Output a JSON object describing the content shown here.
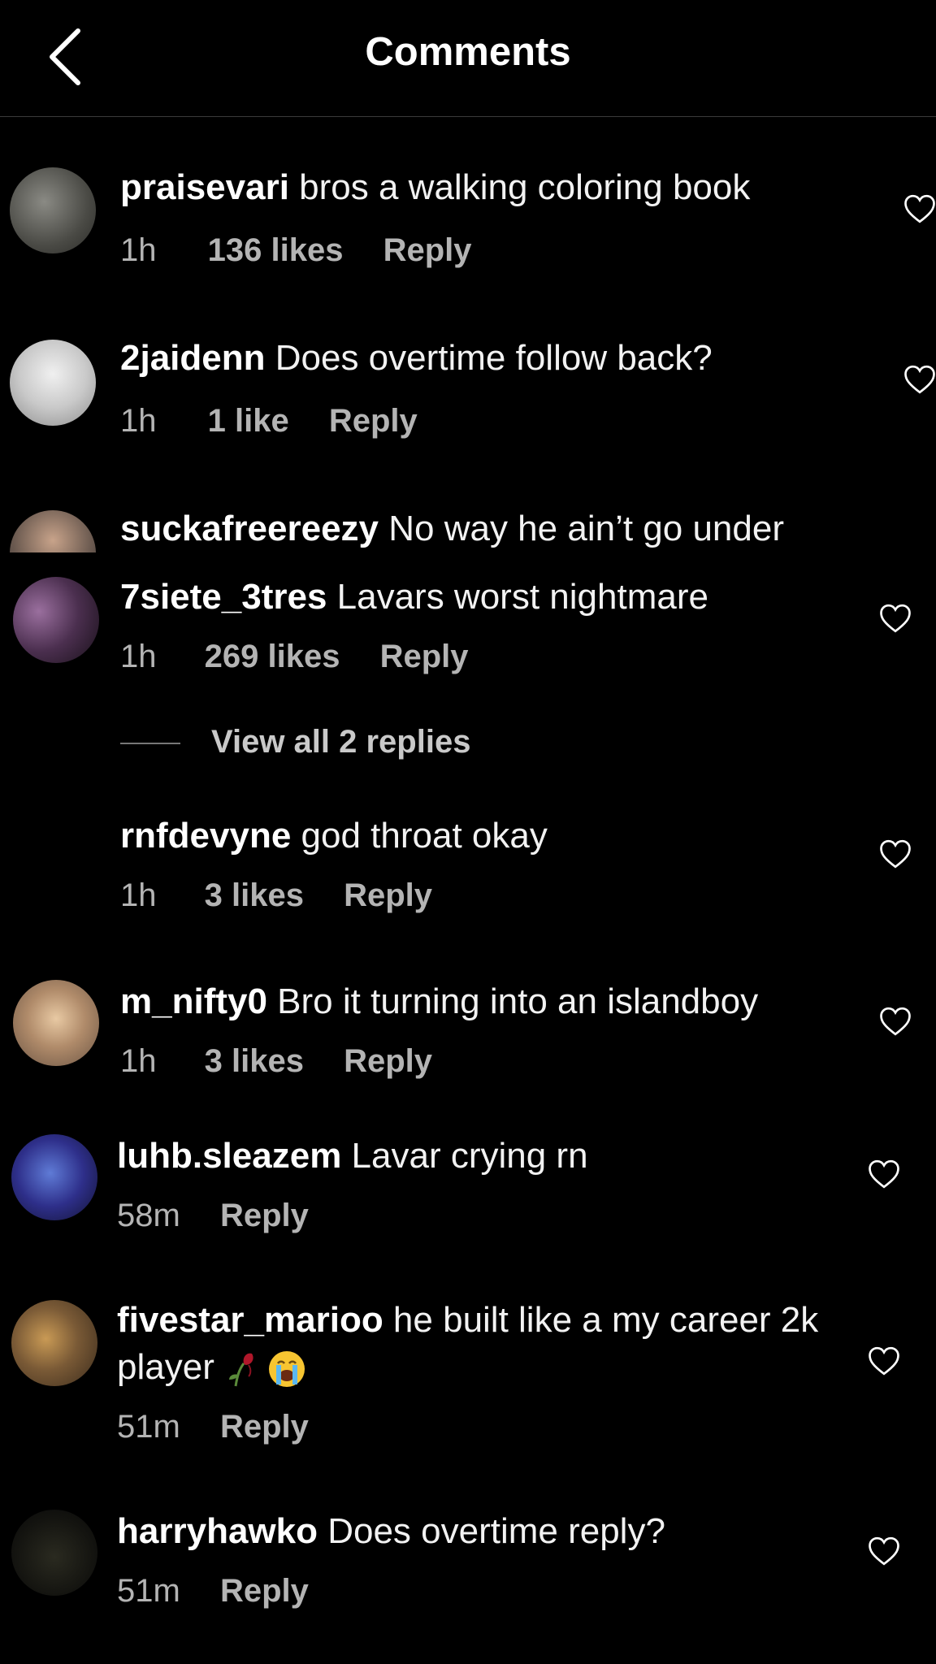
{
  "header": {
    "title": "Comments"
  },
  "reply_label": "Reply",
  "view_replies": "View all 2 replies",
  "comments": [
    {
      "user": "praisevari",
      "text": " bros a walking coloring book",
      "time": "1h",
      "likes": "136 likes"
    },
    {
      "user": "2jaidenn",
      "text": " Does overtime follow back?",
      "time": "1h",
      "likes": "1 like"
    },
    {
      "user": "suckafreereezy",
      "text": " No way he ain’t go under"
    },
    {
      "user": "7siete_3tres",
      "text": " Lavars worst nightmare",
      "time": "1h",
      "likes": "269 likes"
    },
    {
      "user": "rnfdevyne",
      "text": " god throat okay",
      "time": "1h",
      "likes": "3 likes"
    },
    {
      "user": "m_nifty0",
      "text": " Bro it turning into an islandboy",
      "time": "1h",
      "likes": "3 likes"
    },
    {
      "user": "luhb.sleazem",
      "text": " Lavar crying rn",
      "time": "58m"
    },
    {
      "user": "fivestar_marioo",
      "text": " he built like a my career 2k",
      "text2": "player",
      "time": "51m"
    },
    {
      "user": "harryhawko",
      "text": " Does overtime reply?",
      "time": "51m"
    }
  ]
}
